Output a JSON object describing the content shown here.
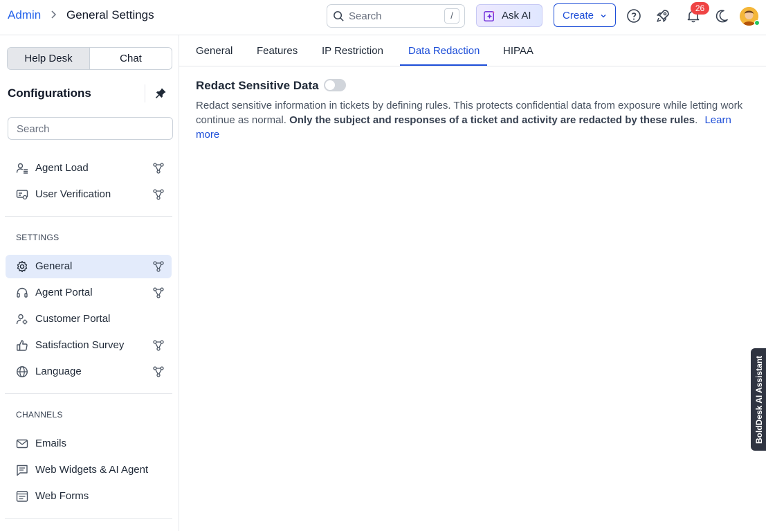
{
  "header": {
    "breadcrumb_root": "Admin",
    "page_title": "General Settings",
    "search_placeholder": "Search",
    "search_shortcut": "/",
    "ask_ai_label": "Ask AI",
    "create_label": "Create",
    "notification_count": "26",
    "icons": [
      "help-icon",
      "rocket-icon",
      "bell-icon",
      "moon-icon"
    ]
  },
  "sidebar": {
    "segments": [
      "Help Desk",
      "Chat"
    ],
    "active_segment": "Help Desk",
    "title": "Configurations",
    "search_placeholder": "Search",
    "top_items": [
      {
        "label": "Agent Load",
        "icon": "user-list-icon"
      },
      {
        "label": "User Verification",
        "icon": "id-card-icon"
      }
    ],
    "settings_title": "SETTINGS",
    "settings_items": [
      {
        "label": "General",
        "icon": "gear-icon",
        "active": true
      },
      {
        "label": "Agent Portal",
        "icon": "headset-icon"
      },
      {
        "label": "Customer Portal",
        "icon": "user-gear-icon"
      },
      {
        "label": "Satisfaction Survey",
        "icon": "thumbs-up-icon"
      },
      {
        "label": "Language",
        "icon": "globe-icon"
      }
    ],
    "channels_title": "CHANNELS",
    "channels_items": [
      {
        "label": "Emails",
        "icon": "mail-icon"
      },
      {
        "label": "Web Widgets & AI Agent",
        "icon": "chat-widget-icon"
      },
      {
        "label": "Web Forms",
        "icon": "form-icon"
      }
    ]
  },
  "tabs": {
    "items": [
      "General",
      "Features",
      "IP Restriction",
      "Data Redaction",
      "HIPAA"
    ],
    "active": "Data Redaction"
  },
  "content": {
    "title": "Redact Sensitive Data",
    "toggle_on": false,
    "desc_part1": "Redact sensitive information in tickets by defining rules. This protects confidential data from exposure while letting work continue as normal.",
    "desc_bold": "Only the subject and responses of a ticket and activity are redacted by these rules",
    "desc_link": "Learn more"
  },
  "assistant_tab": "BoldDesk AI Assistant",
  "colors": {
    "accent": "#1d4ed8",
    "active_bg": "#e3ebfb",
    "badge": "#ef4444"
  }
}
